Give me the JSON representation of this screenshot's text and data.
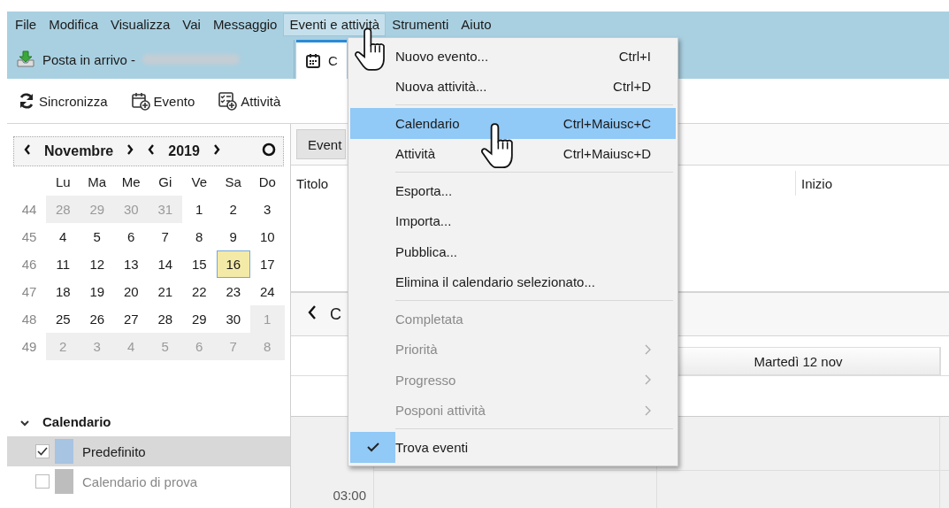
{
  "menubar": [
    {
      "label": "File",
      "selected": false
    },
    {
      "label": "Modifica",
      "selected": false
    },
    {
      "label": "Visualizza",
      "selected": false
    },
    {
      "label": "Vai",
      "selected": false
    },
    {
      "label": "Messaggio",
      "selected": false
    },
    {
      "label": "Eventi e attività",
      "selected": true
    },
    {
      "label": "Strumenti",
      "selected": false
    },
    {
      "label": "Aiuto",
      "selected": false
    }
  ],
  "tabs": [
    {
      "kind": "mail",
      "label": "Posta in arrivo -",
      "selected": false
    },
    {
      "kind": "calendar",
      "label": "C",
      "selected": true
    }
  ],
  "toolbar": [
    {
      "kind": "sync",
      "label": "Sincronizza"
    },
    {
      "kind": "event",
      "label": "Evento"
    },
    {
      "kind": "task",
      "label": "Attività"
    }
  ],
  "minimonth": {
    "month": "Novembre",
    "year": "2019",
    "weekdays": [
      "Lu",
      "Ma",
      "Me",
      "Gi",
      "Ve",
      "Sa",
      "Do"
    ],
    "weeks": [
      {
        "number": "44",
        "days": [
          {
            "label": "28",
            "outside": true,
            "today": false
          },
          {
            "label": "29",
            "outside": true,
            "today": false
          },
          {
            "label": "30",
            "outside": true,
            "today": false
          },
          {
            "label": "31",
            "outside": true,
            "today": false
          },
          {
            "label": "1",
            "outside": false,
            "today": false
          },
          {
            "label": "2",
            "outside": false,
            "today": false
          },
          {
            "label": "3",
            "outside": false,
            "today": false
          }
        ]
      },
      {
        "number": "45",
        "days": [
          {
            "label": "4",
            "outside": false,
            "today": false
          },
          {
            "label": "5",
            "outside": false,
            "today": false
          },
          {
            "label": "6",
            "outside": false,
            "today": false
          },
          {
            "label": "7",
            "outside": false,
            "today": false
          },
          {
            "label": "8",
            "outside": false,
            "today": false
          },
          {
            "label": "9",
            "outside": false,
            "today": false
          },
          {
            "label": "10",
            "outside": false,
            "today": false
          }
        ]
      },
      {
        "number": "46",
        "days": [
          {
            "label": "11",
            "outside": false,
            "today": false
          },
          {
            "label": "12",
            "outside": false,
            "today": false
          },
          {
            "label": "13",
            "outside": false,
            "today": false
          },
          {
            "label": "14",
            "outside": false,
            "today": false
          },
          {
            "label": "15",
            "outside": false,
            "today": false
          },
          {
            "label": "16",
            "outside": false,
            "today": true
          },
          {
            "label": "17",
            "outside": false,
            "today": false
          }
        ]
      },
      {
        "number": "47",
        "days": [
          {
            "label": "18",
            "outside": false,
            "today": false
          },
          {
            "label": "19",
            "outside": false,
            "today": false
          },
          {
            "label": "20",
            "outside": false,
            "today": false
          },
          {
            "label": "21",
            "outside": false,
            "today": false
          },
          {
            "label": "22",
            "outside": false,
            "today": false
          },
          {
            "label": "23",
            "outside": false,
            "today": false
          },
          {
            "label": "24",
            "outside": false,
            "today": false
          }
        ]
      },
      {
        "number": "48",
        "days": [
          {
            "label": "25",
            "outside": false,
            "today": false
          },
          {
            "label": "26",
            "outside": false,
            "today": false
          },
          {
            "label": "27",
            "outside": false,
            "today": false
          },
          {
            "label": "28",
            "outside": false,
            "today": false
          },
          {
            "label": "29",
            "outside": false,
            "today": false
          },
          {
            "label": "30",
            "outside": false,
            "today": false
          },
          {
            "label": "1",
            "outside": true,
            "today": false
          }
        ]
      },
      {
        "number": "49",
        "days": [
          {
            "label": "2",
            "outside": true,
            "today": false
          },
          {
            "label": "3",
            "outside": true,
            "today": false
          },
          {
            "label": "4",
            "outside": true,
            "today": false
          },
          {
            "label": "5",
            "outside": true,
            "today": false
          },
          {
            "label": "6",
            "outside": true,
            "today": false
          },
          {
            "label": "7",
            "outside": true,
            "today": false
          },
          {
            "label": "8",
            "outside": true,
            "today": false
          }
        ]
      }
    ]
  },
  "calendars": {
    "title": "Calendario",
    "expanded": true,
    "items": [
      {
        "name": "Predefinito",
        "checked": true,
        "selected": true,
        "color": "#a7c4e2"
      },
      {
        "name": "Calendario di prova",
        "checked": false,
        "selected": false,
        "color": "#bdbdbd"
      }
    ]
  },
  "main": {
    "filter_button": "Event",
    "columns": [
      "Titolo",
      "Inizio"
    ],
    "nav_label": "C",
    "day_header": "Martedì 12 nov",
    "time": "03:00"
  },
  "menu": [
    {
      "kind": "item",
      "label": "Nuovo evento...",
      "shortcut": "Ctrl+I",
      "disabled": false,
      "selected": false,
      "submenu": false,
      "checked": false
    },
    {
      "kind": "item",
      "label": "Nuova attività...",
      "shortcut": "Ctrl+D",
      "disabled": false,
      "selected": false,
      "submenu": false,
      "checked": false
    },
    {
      "kind": "separator"
    },
    {
      "kind": "item",
      "label": "Calendario",
      "shortcut": "Ctrl+Maiusc+C",
      "disabled": false,
      "selected": true,
      "submenu": false,
      "checked": false
    },
    {
      "kind": "item",
      "label": "Attività",
      "shortcut": "Ctrl+Maiusc+D",
      "disabled": false,
      "selected": false,
      "submenu": false,
      "checked": false
    },
    {
      "kind": "separator"
    },
    {
      "kind": "item",
      "label": "Esporta...",
      "disabled": false,
      "selected": false,
      "submenu": false,
      "checked": false
    },
    {
      "kind": "item",
      "label": "Importa...",
      "disabled": false,
      "selected": false,
      "submenu": false,
      "checked": false
    },
    {
      "kind": "item",
      "label": "Pubblica...",
      "disabled": false,
      "selected": false,
      "submenu": false,
      "checked": false
    },
    {
      "kind": "item",
      "label": "Elimina il calendario selezionato...",
      "disabled": false,
      "selected": false,
      "submenu": false,
      "checked": false
    },
    {
      "kind": "separator"
    },
    {
      "kind": "item",
      "label": "Completata",
      "disabled": true,
      "selected": false,
      "submenu": false,
      "checked": false
    },
    {
      "kind": "item",
      "label": "Priorità",
      "disabled": true,
      "selected": false,
      "submenu": true,
      "checked": false
    },
    {
      "kind": "item",
      "label": "Progresso",
      "disabled": true,
      "selected": false,
      "submenu": true,
      "checked": false
    },
    {
      "kind": "item",
      "label": "Posponi attività",
      "disabled": true,
      "selected": false,
      "submenu": true,
      "checked": false
    },
    {
      "kind": "separator"
    },
    {
      "kind": "item",
      "label": "Trova eventi",
      "disabled": false,
      "selected": false,
      "submenu": false,
      "checked": true
    }
  ]
}
